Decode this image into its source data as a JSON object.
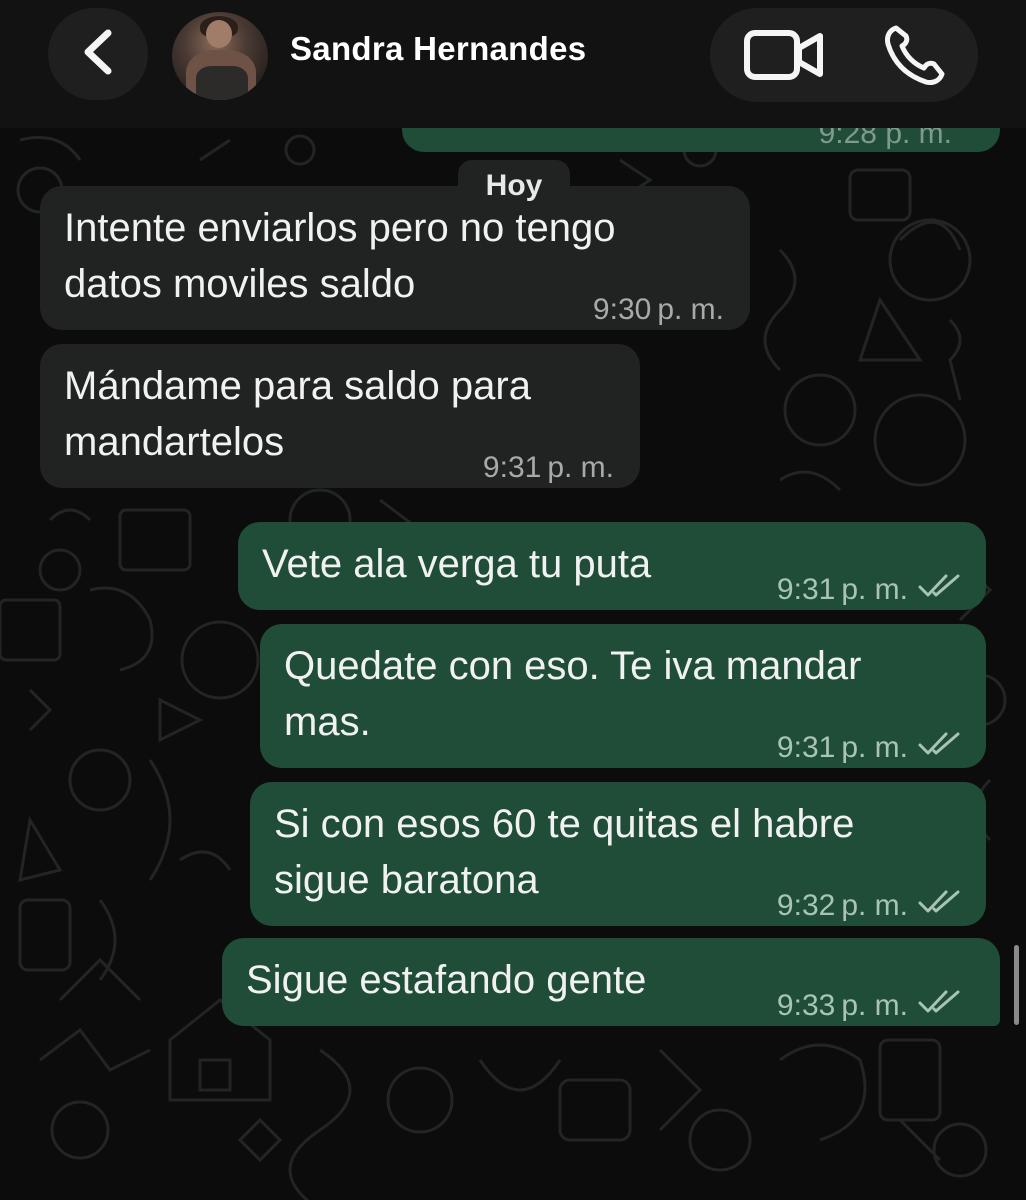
{
  "header": {
    "contact_name": "Sandra Hernandes",
    "back_icon": "chevron-left-icon",
    "video_icon": "video-camera-icon",
    "phone_icon": "phone-icon"
  },
  "date_separator": "Hoy",
  "top_partial_time": "9:28 p. m.",
  "messages": [
    {
      "direction": "incoming",
      "lines": [
        "Intente enviarlos pero no tengo",
        "datos moviles saldo"
      ],
      "time": "9:30",
      "ampm": "p. m."
    },
    {
      "direction": "incoming",
      "lines": [
        "Mándame para saldo para",
        "mandartelos"
      ],
      "time": "9:31",
      "ampm": "p. m."
    },
    {
      "direction": "outgoing",
      "lines": [
        "Vete ala verga tu puta"
      ],
      "time": "9:31",
      "ampm": "p. m.",
      "status": "delivered"
    },
    {
      "direction": "outgoing",
      "lines": [
        "Quedate con eso. Te iva mandar",
        "mas."
      ],
      "time": "9:31",
      "ampm": "p. m.",
      "status": "delivered"
    },
    {
      "direction": "outgoing",
      "lines": [
        "Si con esos 60 te quitas el habre",
        "sigue baratona"
      ],
      "time": "9:32",
      "ampm": "p. m.",
      "status": "delivered"
    },
    {
      "direction": "outgoing",
      "lines": [
        "Sigue estafando gente"
      ],
      "time": "9:33",
      "ampm": "p. m.",
      "status": "delivered"
    }
  ],
  "colors": {
    "background": "#0b0c0b",
    "header": "#121212",
    "incoming_bubble": "#202322",
    "outgoing_bubble": "#1f4d38",
    "timestamp": "#a6aba8"
  }
}
